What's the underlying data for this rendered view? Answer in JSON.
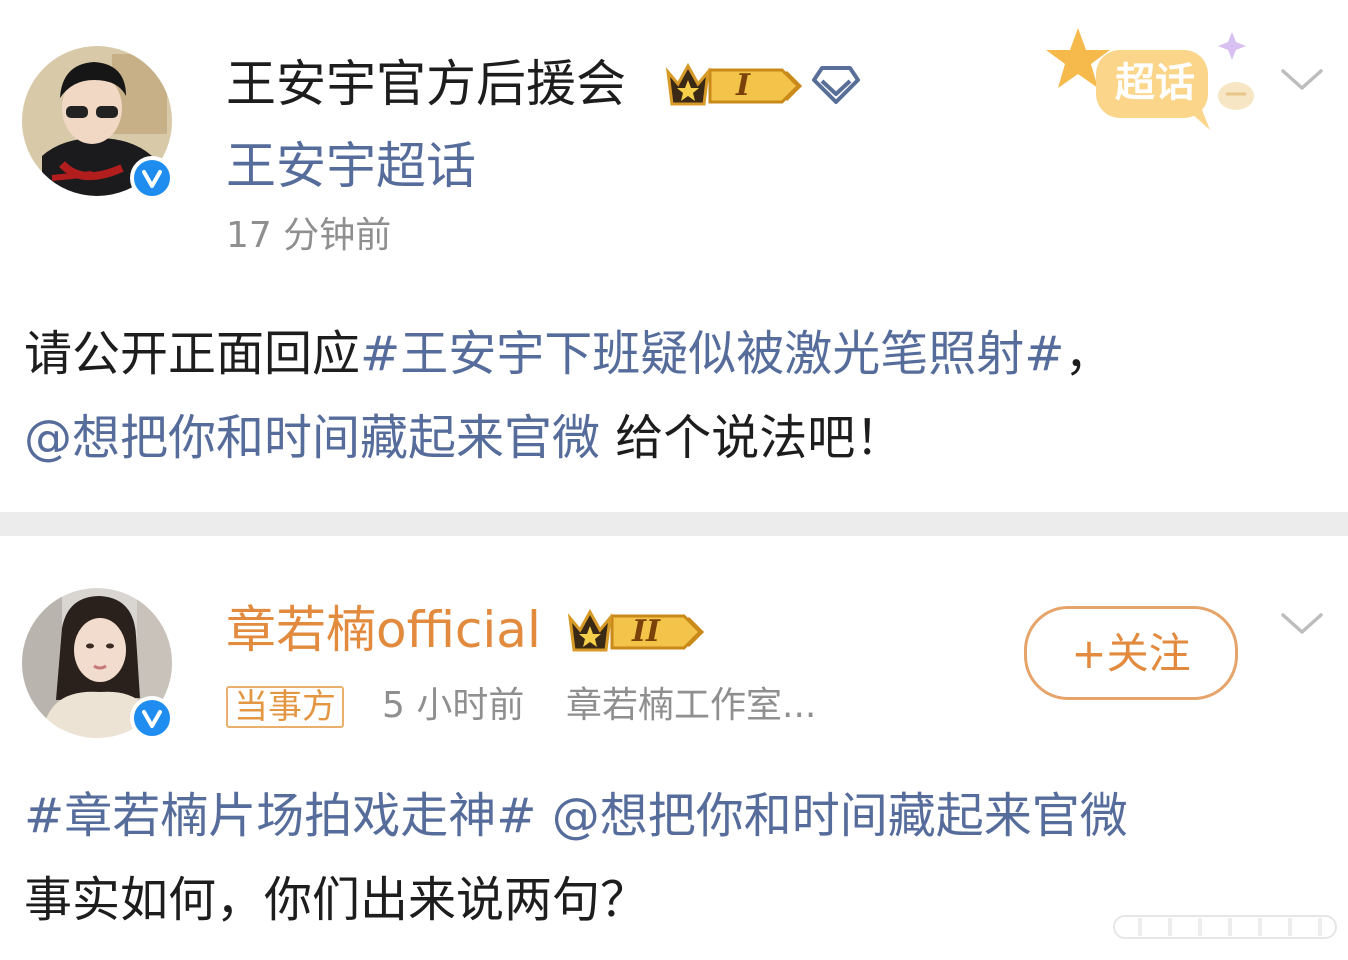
{
  "post1": {
    "author": "王安宇官方后援会",
    "level_badge": "I",
    "supertopic_link": "王安宇超话",
    "time": "17 分钟前",
    "supertopic_badge": "超话",
    "text_line1_plain": "请公开正面回应",
    "text_line1_hashtag": "#王安宇下班疑似被激光笔照射#",
    "text_line1_tail": "，",
    "text_line2_mention": "@想把你和时间藏起来官微",
    "text_line2_tail": " 给个说法吧！"
  },
  "post2": {
    "author": "章若楠official",
    "level_badge": "II",
    "follow_label": "+关注",
    "party_tag": "当事方",
    "time": "5 小时前",
    "source": "章若楠工作室...",
    "text_line1_hashtag": "#章若楠片场拍戏走神#",
    "text_line1_mention": " @想把你和时间藏起来官微",
    "text_line2": "事实如何，你们出来说两句？"
  },
  "colors": {
    "link": "#566c9b",
    "vip_name": "#e28a3d",
    "verified_blue": "#1f8cf0",
    "divider": "#ececec"
  }
}
